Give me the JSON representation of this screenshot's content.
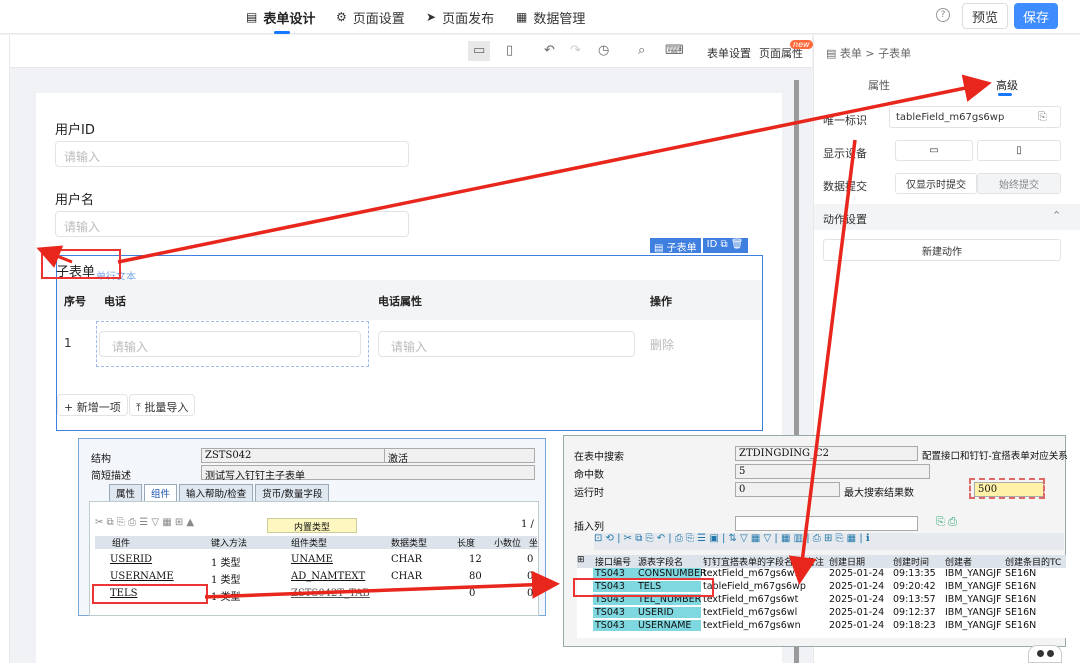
{
  "topnav": {
    "tabs": [
      {
        "label": "表单设计",
        "icon": "form-icon",
        "active": true
      },
      {
        "label": "页面设置",
        "icon": "gear-icon"
      },
      {
        "label": "页面发布",
        "icon": "send-icon"
      },
      {
        "label": "数据管理",
        "icon": "grid-icon"
      }
    ],
    "preview": "预览",
    "save": "保存",
    "help": "?",
    "accent": "#3f8cff"
  },
  "toolbar": {
    "form_settings": "表单设置",
    "page_props": "页面属性",
    "new_badge": "new"
  },
  "form": {
    "field1_label": "用户ID",
    "field1_placeholder": "请输入",
    "field2_label": "用户名",
    "field2_placeholder": "请输入",
    "subtable_label": "子表单",
    "subtable_hint": "单行文本",
    "subtable_tag": "子表单",
    "id_tag": "ID",
    "columns": [
      "序号",
      "电话",
      "电话属性",
      "操作"
    ],
    "row_index": "1",
    "row_phone_placeholder": "请输入",
    "row_attr_placeholder": "请输入",
    "row_delete": "删除",
    "add_row": "新增一项",
    "batch_import": "批量导入"
  },
  "rpanel": {
    "breadcrumb_root": "表单",
    "breadcrumb_sep": ">",
    "breadcrumb_current": "子表单",
    "tab_props": "属性",
    "tab_advanced": "高级",
    "unique_id_label": "唯一标识",
    "unique_id_value": "tableField_m67gs6wp",
    "display_device_label": "显示设备",
    "data_submit_label": "数据提交",
    "submit_opt1": "仅显示时提交",
    "submit_opt2": "始终提交",
    "action_settings": "动作设置",
    "new_action": "新建动作"
  },
  "sap1": {
    "struct_label": "结构",
    "struct_value": "ZSTS042",
    "status": "激活",
    "desc_label": "简短描述",
    "desc_value": "测试写入钉钉主子表单",
    "tabs": [
      "属性",
      "组件",
      "输入帮助/检查",
      "货币/数量字段"
    ],
    "builtin_type": "内置类型",
    "page": "1 /",
    "headers": [
      "组件",
      "键入方法",
      "组件类型",
      "数据类型",
      "长度",
      "小数位",
      "坐"
    ],
    "rows": [
      {
        "comp": "USERID",
        "method": "1 类型",
        "ctype": "UNAME",
        "dtype": "CHAR",
        "len": "12",
        "dec": "0"
      },
      {
        "comp": "USERNAME",
        "method": "1 类型",
        "ctype": "AD_NAMTEXT",
        "dtype": "CHAR",
        "len": "80",
        "dec": "0"
      },
      {
        "comp": "TELS",
        "method": "1 类型",
        "ctype": "ZSTS042T_TAB",
        "dtype": "",
        "len": "0",
        "dec": "0"
      }
    ]
  },
  "sap2": {
    "search_label": "在表中搜索",
    "search_value": "ZTDINGDING_C2",
    "search_desc": "配置接口和钉钉-宜搭表单对应关系",
    "hits_label": "命中数",
    "hits_value": "5",
    "runtime_label": "运行时",
    "runtime_value": "0",
    "max_label": "最大搜索结果数",
    "max_value": "500",
    "insert_col": "插入列",
    "headers": [
      "接口编号",
      "源表字段名",
      "钉钉宜搭表单的字段名",
      "备注",
      "创建日期",
      "创建时间",
      "创建者",
      "创建条目的TC"
    ],
    "rows": [
      {
        "id": "TS043",
        "src": "CONSNUMBER",
        "field": "textField_m67gs6wr",
        "date": "2025-01-24",
        "time": "09:13:35",
        "user": "IBM_YANGJF",
        "tc": "SE16N"
      },
      {
        "id": "TS043",
        "src": "TELS",
        "field": "tableField_m67gs6wp",
        "date": "2025-01-24",
        "time": "09:20:42",
        "user": "IBM_YANGJF",
        "tc": "SE16N"
      },
      {
        "id": "TS043",
        "src": "TEL_NUMBER",
        "field": "textField_m67gs6wt",
        "date": "2025-01-24",
        "time": "09:13:57",
        "user": "IBM_YANGJF",
        "tc": "SE16N"
      },
      {
        "id": "TS043",
        "src": "USERID",
        "field": "textField_m67gs6wl",
        "date": "2025-01-24",
        "time": "09:12:37",
        "user": "IBM_YANGJF",
        "tc": "SE16N"
      },
      {
        "id": "TS043",
        "src": "USERNAME",
        "field": "textField_m67gs6wn",
        "date": "2025-01-24",
        "time": "09:18:23",
        "user": "IBM_YANGJF",
        "tc": "SE16N"
      }
    ]
  },
  "colors": {
    "annotation_red": "#e8261c",
    "primary_blue": "#3f7fe0"
  }
}
